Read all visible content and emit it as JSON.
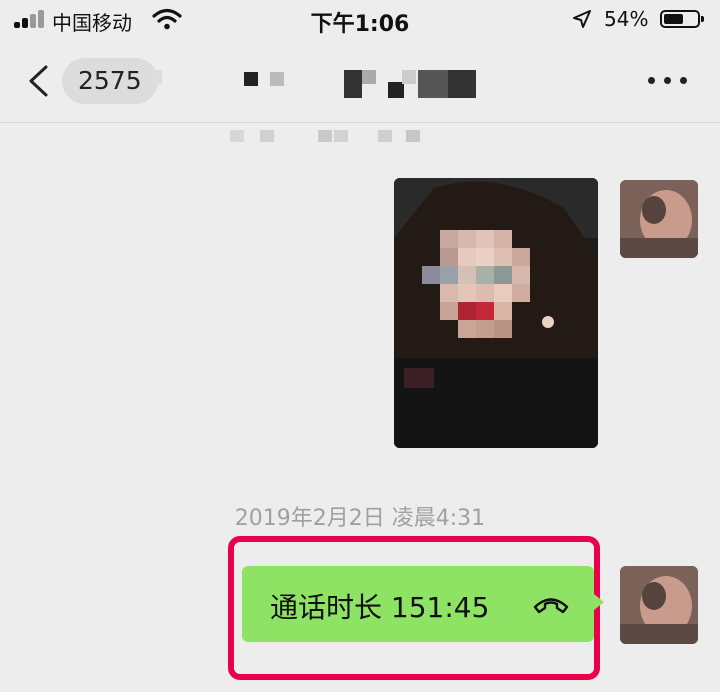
{
  "status_bar": {
    "carrier": "中国移动",
    "time": "下午1:06",
    "battery_percent": "54%",
    "battery_level": 0.54,
    "icons": [
      "signal-icon",
      "wifi-icon",
      "location-icon",
      "battery-icon"
    ]
  },
  "nav": {
    "back_icon": "chevron-left-icon",
    "unread_count": "2575",
    "more_icon": "more-dots-icon"
  },
  "messages": {
    "timestamp": "2019年2月2日 凌晨4:31",
    "call": {
      "text": "通话时长 151:45",
      "icon": "phone-hangup-icon"
    }
  },
  "colors": {
    "background": "#ededed",
    "bubble_green": "#8fe364",
    "highlight_red": "#e8004a"
  }
}
